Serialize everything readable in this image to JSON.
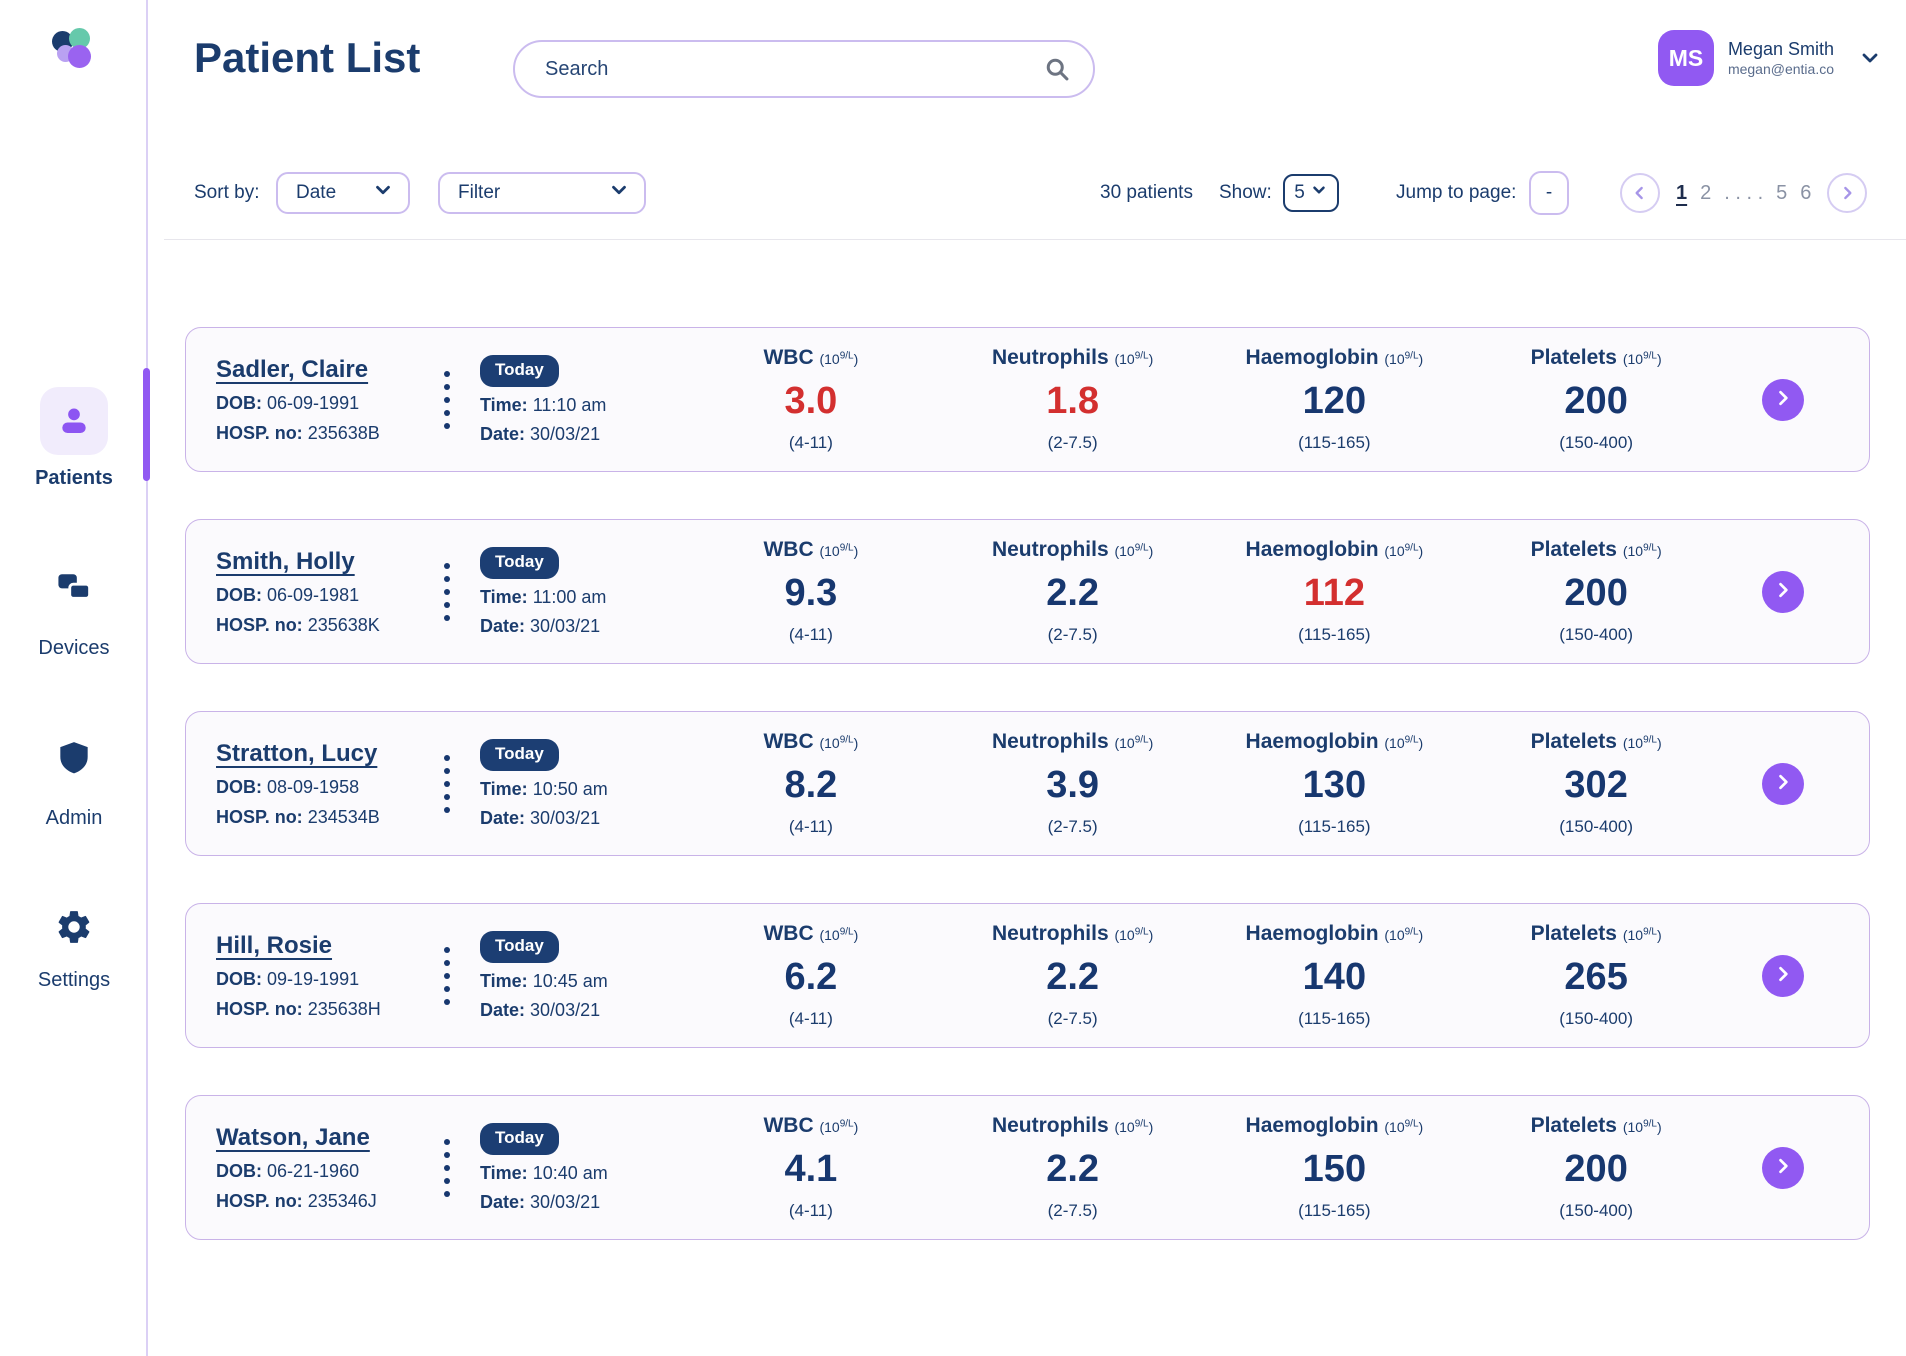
{
  "header": {
    "title": "Patient List",
    "search_placeholder": "Search",
    "user": {
      "initials": "MS",
      "name": "Megan Smith",
      "email": "megan@entia.co"
    }
  },
  "sidebar": {
    "items": [
      {
        "label": "Patients",
        "icon": "person-icon",
        "active": true
      },
      {
        "label": "Devices",
        "icon": "devices-icon",
        "active": false
      },
      {
        "label": "Admin",
        "icon": "shield-icon",
        "active": false
      },
      {
        "label": "Settings",
        "icon": "gear-icon",
        "active": false
      }
    ]
  },
  "toolbar": {
    "sort_label": "Sort by:",
    "sort_value": "Date",
    "filter_value": "Filter",
    "patient_count": "30 patients",
    "show_label": "Show:",
    "show_value": "5",
    "jump_label": "Jump to page:",
    "jump_value": "-",
    "pagination": {
      "pages": [
        "1",
        "2",
        ". . . .",
        "5",
        "6"
      ],
      "current": "1"
    }
  },
  "labels": {
    "dob": "DOB:",
    "hosp": "HOSP. no:",
    "time": "Time:",
    "date": "Date:"
  },
  "metrics_meta": [
    {
      "label": "WBC",
      "unit_base": "(10",
      "unit_sup": "9/L",
      "unit_close": ")",
      "range": "(4-11)"
    },
    {
      "label": "Neutrophils",
      "unit_base": "(10",
      "unit_sup": "9/L",
      "unit_close": ")",
      "range": "(2-7.5)"
    },
    {
      "label": "Haemoglobin",
      "unit_base": "(10",
      "unit_sup": "9/L",
      "unit_close": ")",
      "range": "(115-165)"
    },
    {
      "label": "Platelets",
      "unit_base": "(10",
      "unit_sup": "9/L",
      "unit_close": ")",
      "range": "(150-400)"
    }
  ],
  "patients": [
    {
      "name": "Sadler, Claire",
      "dob": "06-09-1991",
      "hosp_no": "235638B",
      "badge": "Today",
      "time": "11:10 am",
      "date": "30/03/21",
      "metrics": [
        {
          "value": "3.0",
          "status": "alert"
        },
        {
          "value": "1.8",
          "status": "alert"
        },
        {
          "value": "120",
          "status": "normal"
        },
        {
          "value": "200",
          "status": "normal"
        }
      ]
    },
    {
      "name": "Smith, Holly",
      "dob": "06-09-1981",
      "hosp_no": "235638K",
      "badge": "Today",
      "time": "11:00 am",
      "date": "30/03/21",
      "metrics": [
        {
          "value": "9.3",
          "status": "normal"
        },
        {
          "value": "2.2",
          "status": "normal"
        },
        {
          "value": "112",
          "status": "alert"
        },
        {
          "value": "200",
          "status": "normal"
        }
      ]
    },
    {
      "name": "Stratton, Lucy",
      "dob": "08-09-1958",
      "hosp_no": "234534B",
      "badge": "Today",
      "time": "10:50 am",
      "date": "30/03/21",
      "metrics": [
        {
          "value": "8.2",
          "status": "normal"
        },
        {
          "value": "3.9",
          "status": "normal"
        },
        {
          "value": "130",
          "status": "normal"
        },
        {
          "value": "302",
          "status": "normal"
        }
      ]
    },
    {
      "name": "Hill, Rosie",
      "dob": "09-19-1991",
      "hosp_no": "235638H",
      "badge": "Today",
      "time": "10:45 am",
      "date": "30/03/21",
      "metrics": [
        {
          "value": "6.2",
          "status": "normal"
        },
        {
          "value": "2.2",
          "status": "normal"
        },
        {
          "value": "140",
          "status": "normal"
        },
        {
          "value": "265",
          "status": "normal"
        }
      ]
    },
    {
      "name": "Watson, Jane",
      "dob": "06-21-1960",
      "hosp_no": "235346J",
      "badge": "Today",
      "time": "10:40 am",
      "date": "30/03/21",
      "metrics": [
        {
          "value": "4.1",
          "status": "normal"
        },
        {
          "value": "2.2",
          "status": "normal"
        },
        {
          "value": "150",
          "status": "normal"
        },
        {
          "value": "200",
          "status": "normal"
        }
      ]
    }
  ],
  "colors": {
    "navy": "#1b3c6d",
    "navy_deep": "#17376f",
    "purple": "#9159f2",
    "alert_red": "#d32f2f",
    "card_border": "#c9b3e8",
    "card_bg": "#fbfafd",
    "pill_border": "#cbbcef",
    "badge_navy": "#1c3e73",
    "teal": "#66c9ab",
    "lavender": "#f1ecfc"
  }
}
